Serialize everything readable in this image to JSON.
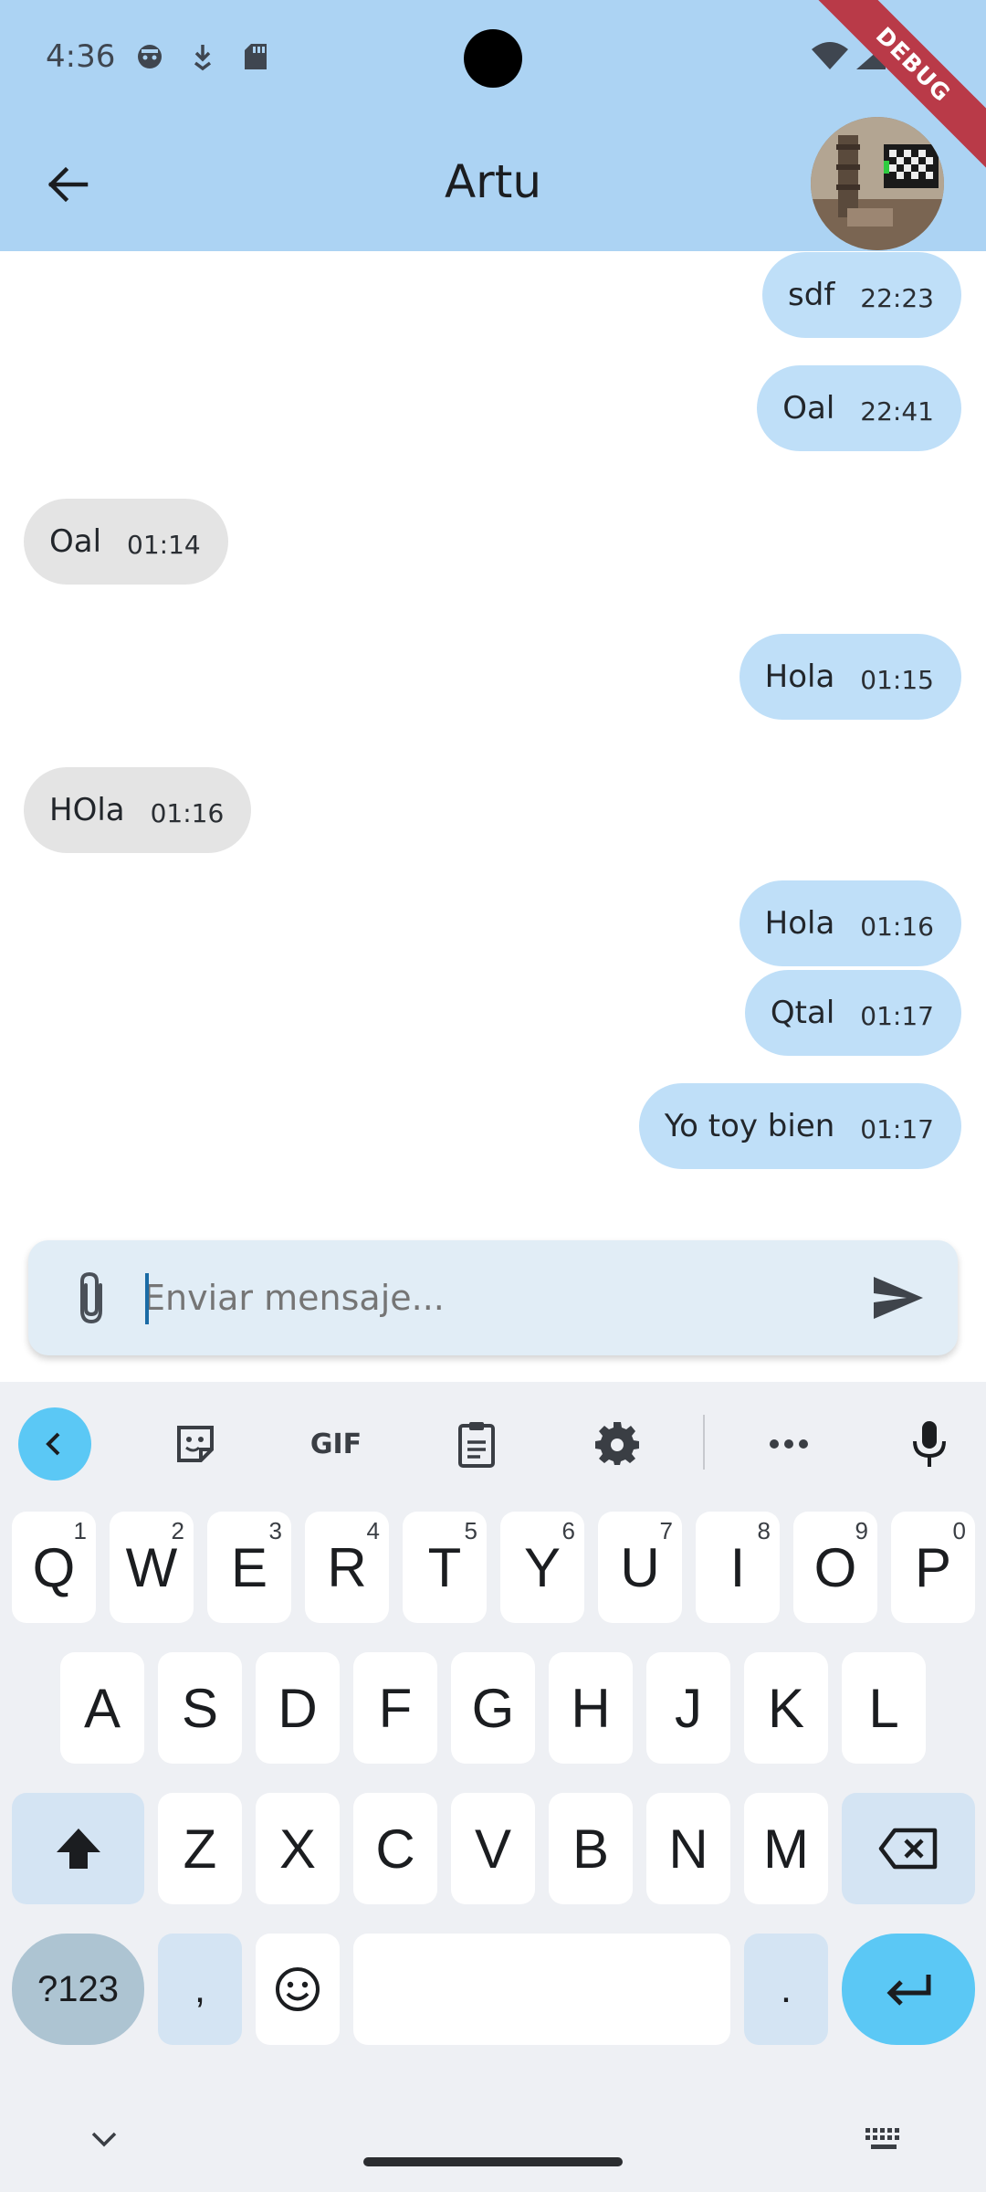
{
  "status_bar": {
    "time": "4:36",
    "icons": [
      "face-icon",
      "download-icon",
      "sdcard-icon",
      "wifi-icon",
      "signal-icon",
      "battery-icon"
    ]
  },
  "debug_banner": "DEBUG",
  "app_bar": {
    "title": "Artu",
    "back_icon": "arrow-back-icon",
    "avatar": "contact-avatar"
  },
  "messages": [
    {
      "direction": "out",
      "text": "sdf",
      "time": "22:23"
    },
    {
      "direction": "out",
      "text": "Oal",
      "time": "22:41"
    },
    {
      "direction": "in",
      "text": "Oal",
      "time": "01:14"
    },
    {
      "direction": "out",
      "text": "Hola",
      "time": "01:15"
    },
    {
      "direction": "in",
      "text": "HOla",
      "time": "01:16"
    },
    {
      "direction": "out",
      "text": "Hola",
      "time": "01:16"
    },
    {
      "direction": "out",
      "text": "Qtal",
      "time": "01:17"
    },
    {
      "direction": "out",
      "text": "Yo toy bien",
      "time": "01:17"
    }
  ],
  "composer": {
    "placeholder": "Enviar mensaje...",
    "value": "",
    "attach_icon": "paperclip-icon",
    "send_icon": "send-icon"
  },
  "keyboard": {
    "toolbar": {
      "gif_label": "GIF",
      "items": [
        "collapse-icon",
        "sticker-icon",
        "gif",
        "clipboard-icon",
        "settings-icon",
        "more-icon",
        "mic-icon"
      ]
    },
    "row1": [
      {
        "key": "Q",
        "sup": "1"
      },
      {
        "key": "W",
        "sup": "2"
      },
      {
        "key": "E",
        "sup": "3"
      },
      {
        "key": "R",
        "sup": "4"
      },
      {
        "key": "T",
        "sup": "5"
      },
      {
        "key": "Y",
        "sup": "6"
      },
      {
        "key": "U",
        "sup": "7"
      },
      {
        "key": "I",
        "sup": "8"
      },
      {
        "key": "O",
        "sup": "9"
      },
      {
        "key": "P",
        "sup": "0"
      }
    ],
    "row2": [
      "A",
      "S",
      "D",
      "F",
      "G",
      "H",
      "J",
      "K",
      "L"
    ],
    "row3": [
      "Z",
      "X",
      "C",
      "V",
      "B",
      "N",
      "M"
    ],
    "bottom": {
      "numsym": "?123",
      "comma": ",",
      "period": "."
    },
    "accent_color": "#5bc8f5"
  }
}
